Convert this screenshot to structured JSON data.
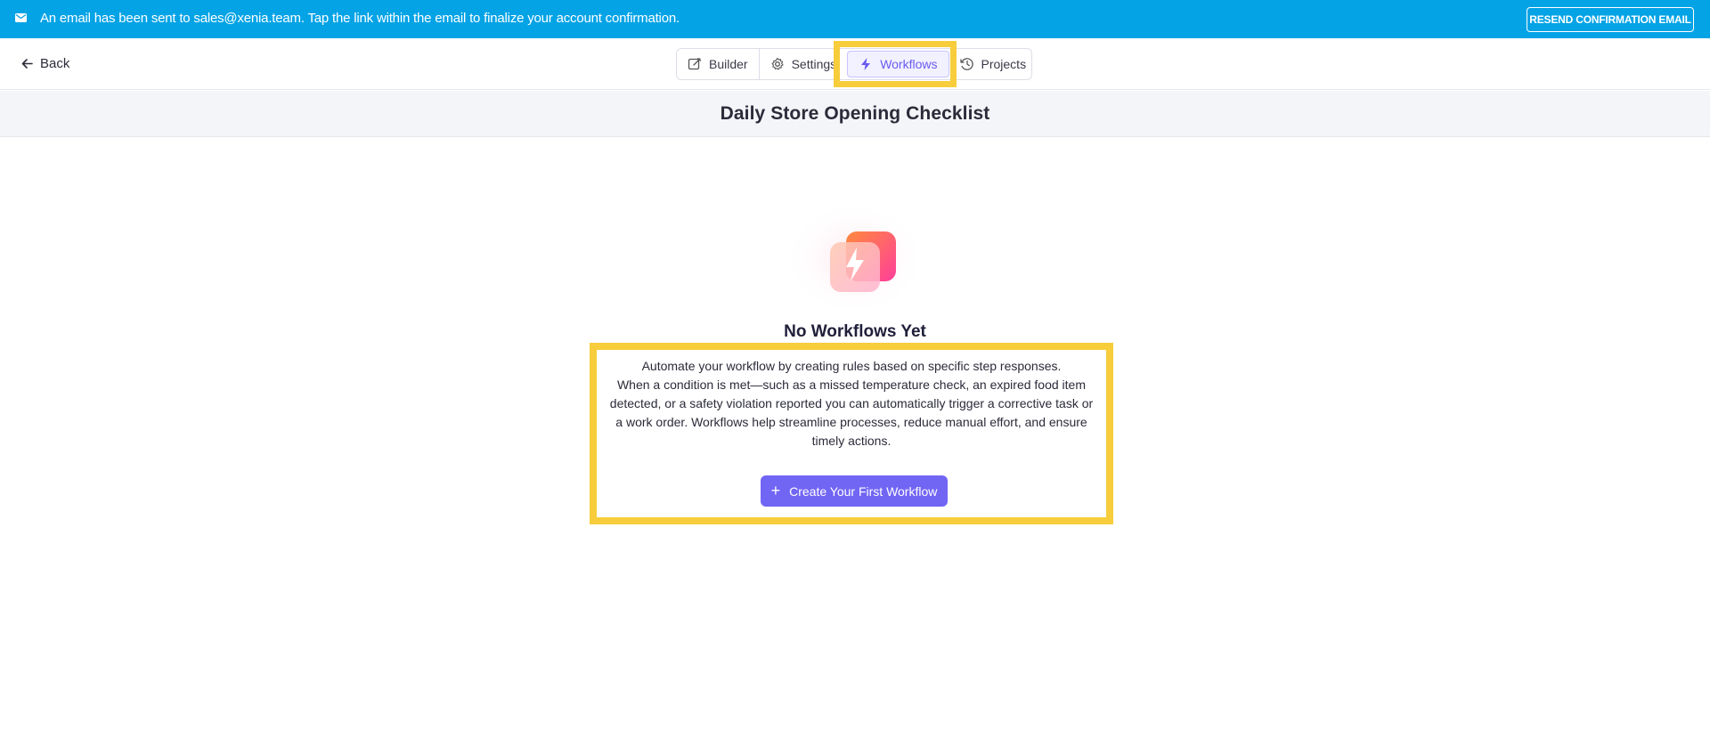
{
  "banner": {
    "message": "An email has been sent to sales@xenia.team. Tap the link within the email to finalize your account confirmation.",
    "resend_label": "RESEND CONFIRMATION EMAIL"
  },
  "header": {
    "back_label": "Back",
    "tabs": [
      {
        "label": "Builder",
        "icon": "edit-icon"
      },
      {
        "label": "Settings",
        "icon": "gear-icon"
      },
      {
        "label": "Workflows",
        "icon": "lightning-icon",
        "active": true
      },
      {
        "label": "Projects",
        "icon": "clock-icon"
      }
    ]
  },
  "page": {
    "title": "Daily Store Opening Checklist"
  },
  "empty_state": {
    "title": "No Workflows Yet",
    "description_line1": "Automate your workflow by creating rules based on specific step responses.",
    "description_line2": "When a condition is met—such as a missed temperature check, an expired food item detected, or a safety violation reported you can automatically trigger a corrective task or a work order. Workflows help streamline processes, reduce manual effort, and ensure timely actions.",
    "cta_label": "Create Your First Workflow"
  },
  "colors": {
    "banner": "#03a3e6",
    "accent": "#7165f4",
    "highlight": "#f7cd3c"
  }
}
